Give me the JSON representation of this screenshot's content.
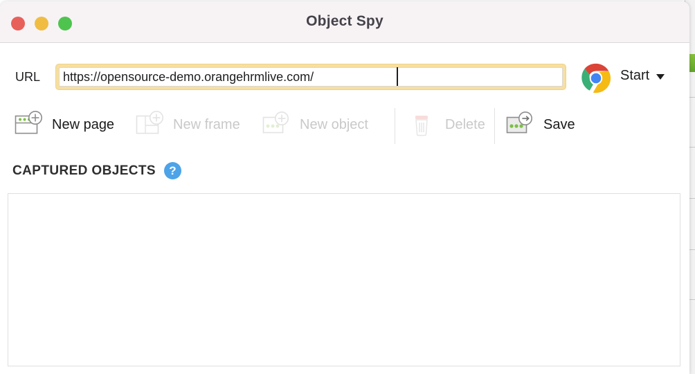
{
  "window": {
    "title": "Object Spy",
    "controls": [
      {
        "name": "close",
        "color": "#e8605a"
      },
      {
        "name": "minimize",
        "color": "#f0bd42"
      },
      {
        "name": "maximize",
        "color": "#4ec44e"
      }
    ]
  },
  "url_bar": {
    "label": "URL",
    "value": "https://opensource-demo.orangehrmlive.com/",
    "placeholder": "Enter URL",
    "browser_icon": "chrome-icon",
    "start_label": "Start",
    "start_caret": "chevron-down-icon"
  },
  "toolbar": {
    "items": [
      {
        "label": "New page",
        "icon": "new-page-icon",
        "enabled": true
      },
      {
        "label": "New frame",
        "icon": "new-frame-icon",
        "enabled": false
      },
      {
        "label": "New object",
        "icon": "new-object-icon",
        "enabled": false
      },
      {
        "label": "Delete",
        "icon": "trash-icon",
        "enabled": false
      },
      {
        "label": "Save",
        "icon": "save-icon",
        "enabled": true
      }
    ]
  },
  "captured": {
    "title": "CAPTURED OBJECTS",
    "help_icon": "question-mark-icon",
    "help_glyph": "?",
    "rows": []
  },
  "colors": {
    "titlebar_bg": "#f7f3f5",
    "title_text": "#45424a",
    "focus_ring": "#f7dfa0",
    "help_blue": "#4da3e8",
    "disabled_text": "#c9c9c9",
    "panel_border": "#dfdfdf"
  }
}
